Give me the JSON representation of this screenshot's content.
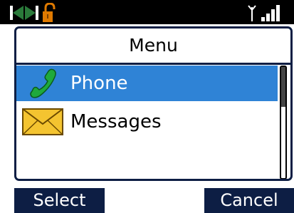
{
  "status_bar": {
    "icons": [
      "skip-icon",
      "unlocked-padlock-icon",
      "antenna-icon",
      "signal-strength-icon"
    ]
  },
  "menu": {
    "title": "Menu",
    "items": [
      {
        "label": "Phone",
        "icon": "phone-handset-icon",
        "selected": true
      },
      {
        "label": "Messages",
        "icon": "envelope-icon",
        "selected": false
      }
    ]
  },
  "softkeys": {
    "left": "Select",
    "right": "Cancel"
  },
  "colors": {
    "status_bar_bg": "#000000",
    "panel_border": "#0d1e44",
    "selection": "#2f83d6",
    "softkey_bg": "#0d1e44",
    "softkey_text": "#ffffff"
  }
}
